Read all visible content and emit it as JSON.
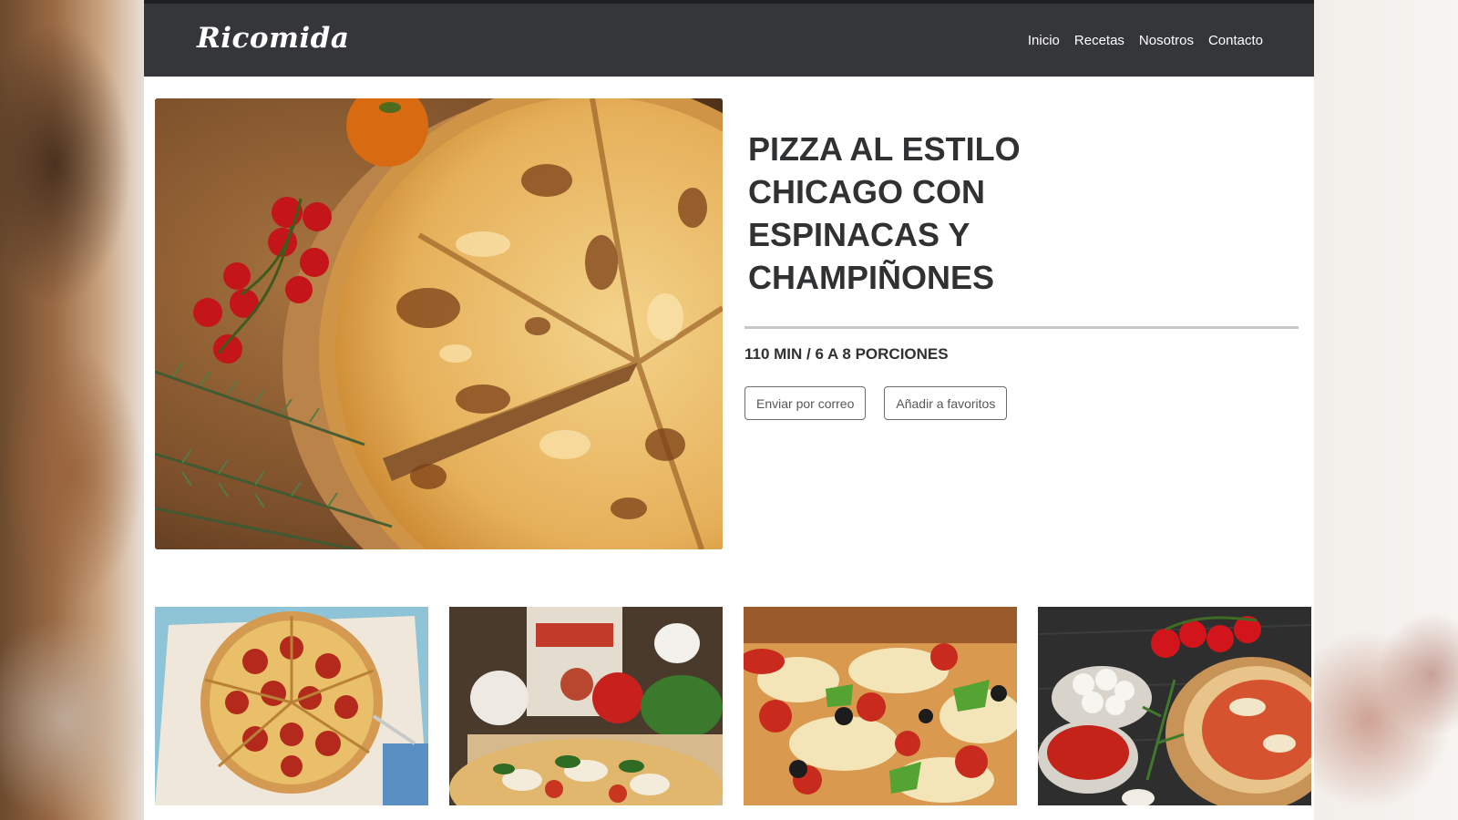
{
  "brand": {
    "name": "Ricomida"
  },
  "nav": {
    "items": [
      {
        "label": "Inicio"
      },
      {
        "label": "Recetas"
      },
      {
        "label": "Nosotros"
      },
      {
        "label": "Contacto"
      }
    ]
  },
  "recipe": {
    "title": "PIZZA AL ESTILO CHICAGO CON ESPINACAS Y CHAMPIÑONES",
    "meta": "110 MIN / 6 A 8 PORCIONES",
    "image_icon": "pizza-photo"
  },
  "actions": {
    "email_label": "Enviar por correo",
    "favorite_label": "Añadir a favoritos"
  },
  "thumbnails": [
    {
      "icon": "pepperoni-pizza-photo"
    },
    {
      "icon": "margherita-pizza-crust-photo"
    },
    {
      "icon": "veggie-pizza-closeup-photo"
    },
    {
      "icon": "pizza-ingredients-photo"
    }
  ],
  "colors": {
    "navbar": "#34363a",
    "text_dark": "#2f3133",
    "divider": "#c7c7c7",
    "button_border": "#6a6c6e"
  }
}
